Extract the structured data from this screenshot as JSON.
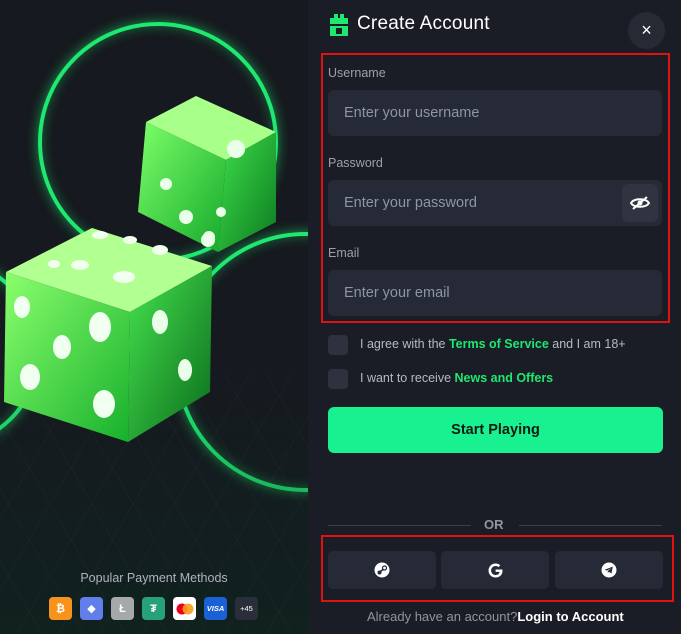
{
  "modal": {
    "title": "Create Account",
    "close_label": "×"
  },
  "form": {
    "username_label": "Username",
    "username_placeholder": "Enter your username",
    "password_label": "Password",
    "password_placeholder": "Enter your password",
    "email_label": "Email",
    "email_placeholder": "Enter your email"
  },
  "checkboxes": {
    "terms_prefix": "I agree with the ",
    "terms_link": "Terms of Service",
    "terms_suffix": " and I am 18+",
    "news_prefix": "I want to receive ",
    "news_link": "News and Offers"
  },
  "start_button": "Start Playing",
  "divider": "OR",
  "social": [
    "steam-icon",
    "google-icon",
    "telegram-icon"
  ],
  "footer": {
    "text": "Already have an account?",
    "link": "Login to Account"
  },
  "payments": {
    "title": "Popular Payment Methods",
    "methods": [
      {
        "name": "bitcoin-icon",
        "glyph": "₿",
        "color": "#f7931a"
      },
      {
        "name": "ethereum-icon",
        "glyph": "◆",
        "color": "#627eea"
      },
      {
        "name": "litecoin-icon",
        "glyph": "Ł",
        "color": "#a6a9aa"
      },
      {
        "name": "tether-icon",
        "glyph": "₮",
        "color": "#26a17b"
      },
      {
        "name": "mastercard-icon",
        "glyph": "",
        "color": "#ffffff"
      },
      {
        "name": "visa-icon",
        "glyph": "VISA",
        "color": "#1a61d6"
      },
      {
        "name": "more-methods-badge",
        "glyph": "+45",
        "color": "#2a2e39"
      }
    ]
  },
  "colors": {
    "accent": "#19f08f",
    "background": "#1a1d26",
    "field": "#252a36",
    "highlight_border": "#e01313"
  }
}
